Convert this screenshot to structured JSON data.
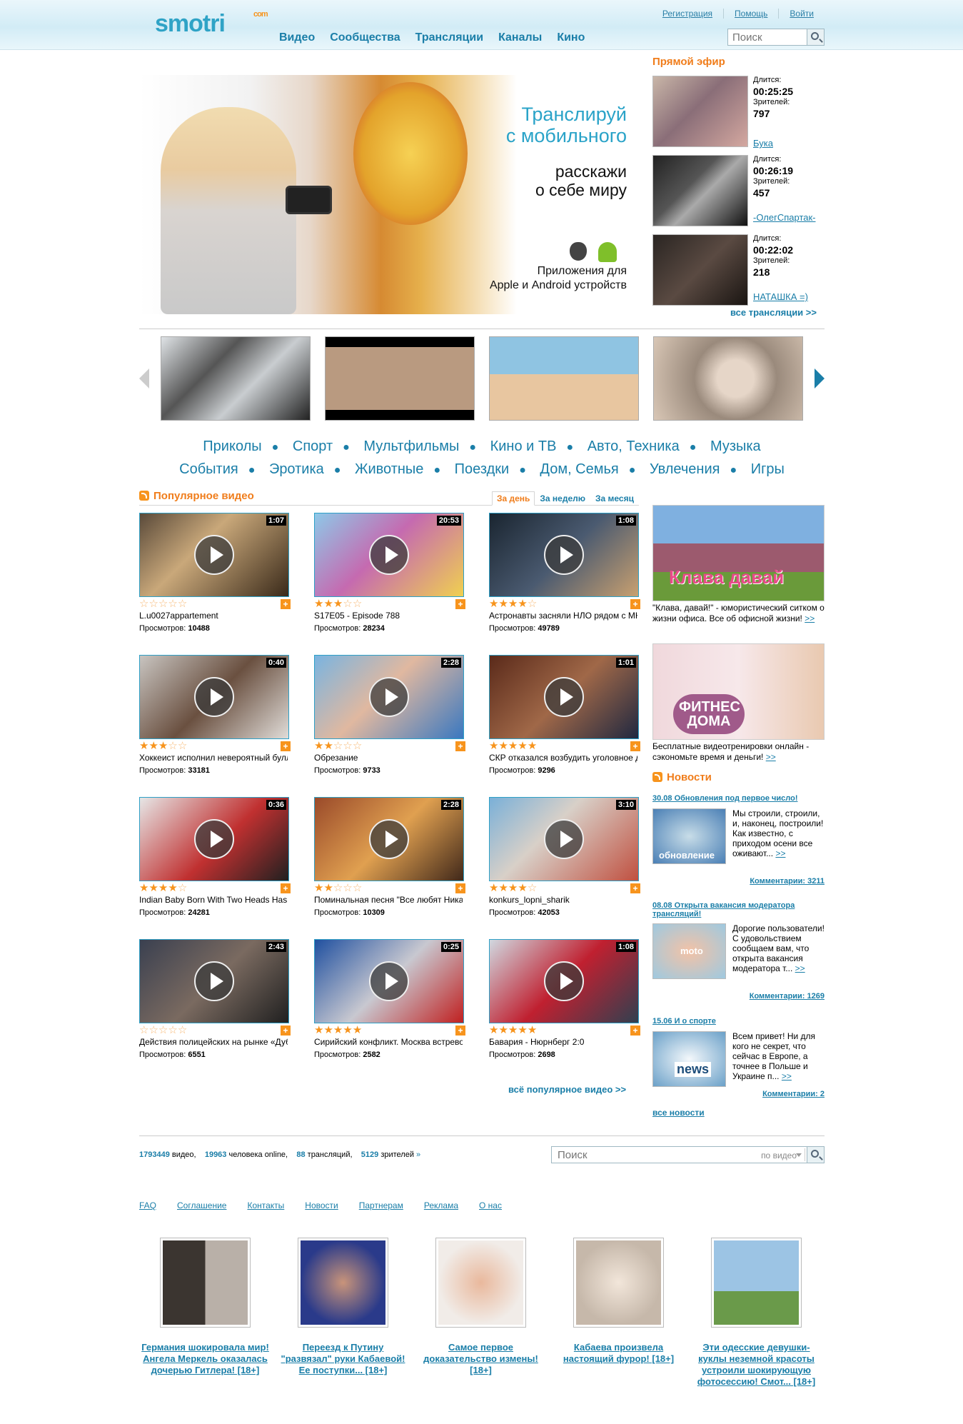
{
  "header": {
    "logo_text": "smotri",
    "logo_suffix": "com",
    "nav": [
      "Видео",
      "Сообщества",
      "Трансляции",
      "Каналы",
      "Кино"
    ],
    "top_links": [
      "Регистрация",
      "Помощь",
      "Войти"
    ],
    "search_placeholder": "Поиск"
  },
  "promo": {
    "title_line1": "Транслируй",
    "title_line2": "с мобильного",
    "subtitle_line1": "расскажи",
    "subtitle_line2": "о себе миру",
    "apps_line1": "Приложения для",
    "apps_line2": "Apple и Android устройств"
  },
  "live": {
    "heading": "Прямой эфир",
    "duration_label": "Длится:",
    "viewers_label": "Зрителей:",
    "items": [
      {
        "duration": "00:25:25",
        "viewers": "797",
        "name": "Бука"
      },
      {
        "duration": "00:26:19",
        "viewers": "457",
        "name": "-ОлегСпартак-"
      },
      {
        "duration": "00:22:02",
        "viewers": "218",
        "name": "НАТАШКА =)"
      }
    ],
    "all_link": "все трансляции >>"
  },
  "categories": {
    "row1": [
      "Приколы",
      "Спорт",
      "Мультфильмы",
      "Кино и ТВ",
      "Авто, Техника",
      "Музыка"
    ],
    "row2": [
      "События",
      "Эротика",
      "Животные",
      "Поездки",
      "Дом, Семья",
      "Увлечения",
      "Игры"
    ]
  },
  "popular": {
    "heading": "Популярное видео",
    "tabs": [
      "За день",
      "За неделю",
      "За месяц"
    ],
    "active_tab": "За день",
    "views_label": "Просмотров:",
    "videos": [
      {
        "duration": "1:07",
        "title": "L.u0027appartement",
        "views": "10488",
        "rating": 0
      },
      {
        "duration": "20:53",
        "title": "S17E05 - Episode 788",
        "views": "28234",
        "rating": 3
      },
      {
        "duration": "1:08",
        "title": "Астронавты засняли НЛО рядом с МКС",
        "views": "49789",
        "rating": 4
      },
      {
        "duration": "0:40",
        "title": "Хоккеист исполнил невероятный буллит",
        "views": "33181",
        "rating": 3
      },
      {
        "duration": "2:28",
        "title": "Обрезание",
        "views": "9733",
        "rating": 2
      },
      {
        "duration": "1:01",
        "title": "СКР отказался возбудить уголовное дело",
        "views": "9296",
        "rating": 5
      },
      {
        "duration": "0:36",
        "title": "Indian Baby Born With Two Heads Has",
        "views": "24281",
        "rating": 4
      },
      {
        "duration": "2:28",
        "title": "Поминальная песня \"Все любят Ника\"",
        "views": "10309",
        "rating": 2
      },
      {
        "duration": "3:10",
        "title": "konkurs_lopni_sharik",
        "views": "42053",
        "rating": 4
      },
      {
        "duration": "2:43",
        "title": "Действия полицейских на рынке «Дубровка»",
        "views": "6551",
        "rating": 0
      },
      {
        "duration": "0:25",
        "title": "Сирийский конфликт. Москва встревожена",
        "views": "2582",
        "rating": 5
      },
      {
        "duration": "1:08",
        "title": "Бавария - Нюрнберг 2:0",
        "views": "2698",
        "rating": 5
      }
    ],
    "all_link": "всё популярное видео >>"
  },
  "ads": [
    {
      "image_text": "Клава давай",
      "text": "\"Клава, давай!\" - юмористический ситком о жизни офиса. Все об офисной жизни!",
      "more": ">>"
    },
    {
      "image_text": "ФИТНЕС ДОМА",
      "text": "Бесплатные видеотренировки онлайн - сэкономьте время и деньги!",
      "more": ">>"
    }
  ],
  "news": {
    "heading": "Новости",
    "items": [
      {
        "title": "30.08 Обновления под первое число!",
        "text": "Мы строили, строили, и, наконец, построили! Как известно, с приходом осени все оживают...",
        "more": ">>",
        "comments": "Комментарии: 3211",
        "image_text": "обновление"
      },
      {
        "title": "08.08 Открыта вакансия модератора трансляций!",
        "text": "Дорогие пользователи! С удовольствием сообщаем вам, что открыта вакансия модератора т...",
        "more": ">>",
        "comments": "Комментарии: 1269",
        "image_text": "moto"
      },
      {
        "title": "15.06 И о спорте",
        "text": "Всем привет! Ни для кого не секрет, что сейчас в Европе, а точнее в Польше и Украине п...",
        "more": ">>",
        "comments": "Комментарии: 2",
        "image_text": "news"
      }
    ],
    "all_link": "все новости"
  },
  "stats": {
    "videos": "1793449",
    "videos_label": "видео,",
    "online": "19963",
    "online_label": "человека online,",
    "broadcasts": "88",
    "broadcasts_label": "трансляций,",
    "viewers": "5129",
    "viewers_label": "зрителей",
    "arrow": "»"
  },
  "footer_search": {
    "placeholder": "Поиск",
    "scope": "по видео"
  },
  "footer_links": [
    "FAQ",
    "Соглашение",
    "Контакты",
    "Новости",
    "Партнерам",
    "Реклама",
    "О нас"
  ],
  "teasers": [
    "Германия шокировала мир! Ангела Меркель оказалась дочерью Гитлера! [18+]",
    "Переезд к Путину \"развязал\" руки Кабаевой! Ее поступки... [18+]",
    "Самое первое доказательство измены! [18+]",
    "Кабаева произвела настоящий фурор! [18+]",
    "Эти одесские девушки-куклы неземной красоты устроили шокирующую фотосессию! Смот... [18+]"
  ],
  "colors": {
    "accent_blue": "#1a7ea8",
    "accent_orange": "#f07d1b",
    "header_bg": "#d2ecf6"
  }
}
